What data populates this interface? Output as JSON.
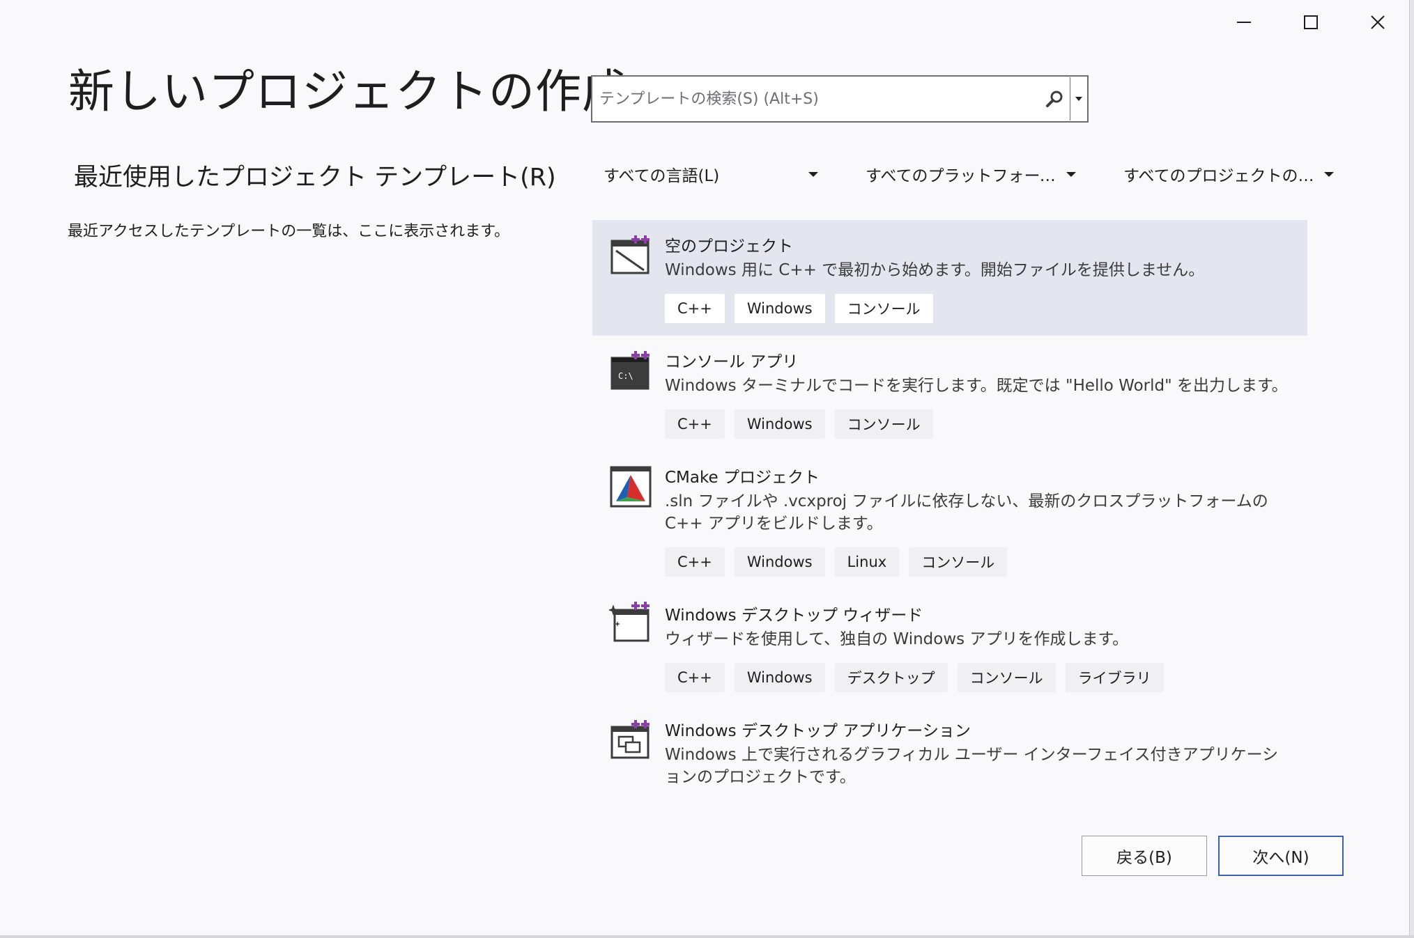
{
  "window": {
    "title": "新しいプロジェクトの作成",
    "minimize_label": "",
    "maximize_label": "",
    "close_label": ""
  },
  "left": {
    "recent_heading": "最近使用したプロジェクト テンプレート(R)",
    "recent_description": "最近アクセスしたテンプレートの一覧は、ここに表示されます。"
  },
  "search": {
    "placeholder": "テンプレートの検索(S) (Alt+S)",
    "value": ""
  },
  "filters": {
    "language": "すべての言語(L)",
    "platform": "すべてのプラットフォーム(P)",
    "project_type": "すべてのプロジェクトの種類..."
  },
  "templates": [
    {
      "name": "空のプロジェクト",
      "description": "Windows 用に C++ で最初から始めます。開始ファイルを提供しません。",
      "tags": [
        "C++",
        "Windows",
        "コンソール"
      ],
      "icon": "empty-project-icon",
      "selected": true
    },
    {
      "name": "コンソール アプリ",
      "description": "Windows ターミナルでコードを実行します。既定では \"Hello World\" を出力します。",
      "tags": [
        "C++",
        "Windows",
        "コンソール"
      ],
      "icon": "console-app-icon",
      "icon_text": "C:\\",
      "selected": false
    },
    {
      "name": "CMake プロジェクト",
      "description": ".sln ファイルや .vcxproj ファイルに依存しない、最新のクロスプラットフォームの C++ アプリをビルドします。",
      "tags": [
        "C++",
        "Windows",
        "Linux",
        "コンソール"
      ],
      "icon": "cmake-icon",
      "selected": false
    },
    {
      "name": "Windows デスクトップ ウィザード",
      "description": "ウィザードを使用して、独自の Windows アプリを作成します。",
      "tags": [
        "C++",
        "Windows",
        "デスクトップ",
        "コンソール",
        "ライブラリ"
      ],
      "icon": "desktop-wizard-icon",
      "selected": false
    },
    {
      "name": "Windows デスクトップ アプリケーション",
      "description": "Windows 上で実行されるグラフィカル ユーザー インターフェイス付きアプリケーションのプロジェクトです。",
      "tags": [],
      "icon": "desktop-application-icon",
      "selected": false
    }
  ],
  "buttons": {
    "back": "戻る(B)",
    "next": "次へ(N)"
  },
  "colors": {
    "selected_bg": "#e4e6ef",
    "accent_border": "#3c62b0",
    "plus_purple": "#8a3fa6",
    "icon_dark": "#3c3c3c"
  }
}
